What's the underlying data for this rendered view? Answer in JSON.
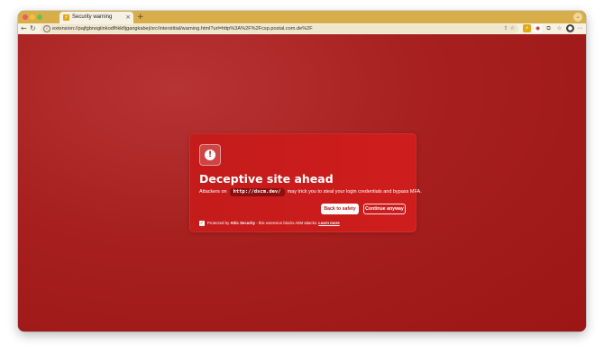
{
  "browser": {
    "tab_title": "Security warning",
    "tab_close": "×",
    "new_tab": "+",
    "url_prefix": "extension://",
    "url_path": "pajfgbnogiinkodfhkkfijgangkabej/src/interstitial/warning.html?url=http%3A%2F%2Fcsp.postal.com.de%2F",
    "back_icon": "←",
    "reload_icon": "↻",
    "menu_icon": "⋯"
  },
  "card": {
    "alert_glyph": "!",
    "title": "Deceptive site ahead",
    "desc_before": "Attackers on",
    "domain": "http://dscm.dev/",
    "desc_after": "may trick you to steal your login credentials and bypass MFA.",
    "back_button": "Back to safety",
    "continue_button": "Continue anyway",
    "check_glyph": "✓",
    "protected_prefix": "Protected by",
    "brand": "Attic Security",
    "protected_suffix": "- this extension blocks AitM attacks.",
    "learn_more": "Learn more"
  },
  "colors": {
    "background": "#a51d1d",
    "card": "#cc1c1c",
    "tab_bar": "#d8ae4a"
  }
}
